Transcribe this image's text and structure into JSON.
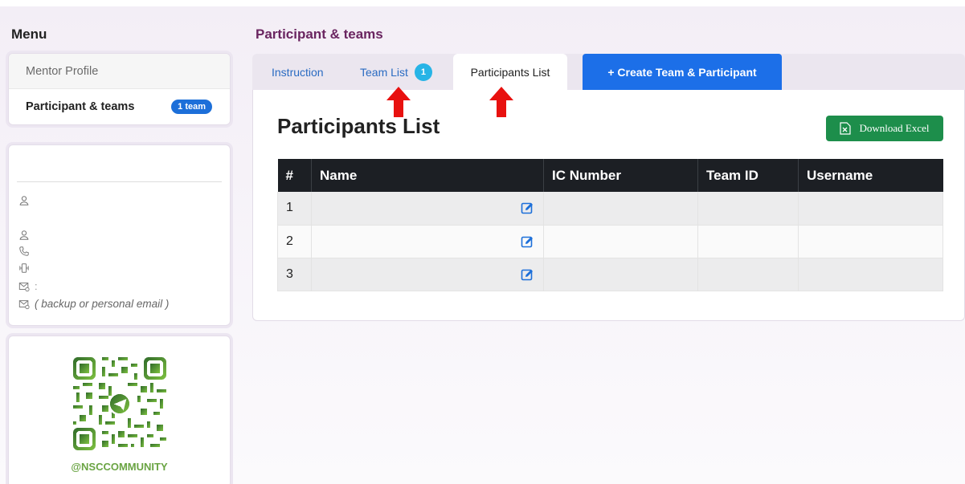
{
  "menu": {
    "title": "Menu",
    "items": [
      {
        "label": "Mentor Profile"
      },
      {
        "label": "Participant & teams",
        "badge": "1 team"
      }
    ]
  },
  "profile": {
    "email_note": "( backup or personal email )"
  },
  "qr": {
    "caption": "@NSCCOMMUNITY",
    "color": "#6aa443"
  },
  "section": {
    "title": "Participant & teams"
  },
  "tabs": {
    "instruction": "Instruction",
    "team_list": "Team List",
    "team_list_count": "1",
    "participants_list": "Participants List",
    "create": "+ Create Team & Participant"
  },
  "panel": {
    "title": "Participants List",
    "download_label": "Download Excel"
  },
  "table": {
    "headers": [
      "#",
      "Name",
      "IC Number",
      "Team ID",
      "Username"
    ],
    "rows": [
      {
        "num": "1"
      },
      {
        "num": "2"
      },
      {
        "num": "3"
      }
    ]
  },
  "colors": {
    "accent": "#1c6fe8",
    "section_title": "#6a2560",
    "excel_green": "#1d8e4b",
    "table_header": "#1c1f24",
    "annotation_red": "#e8110f"
  }
}
